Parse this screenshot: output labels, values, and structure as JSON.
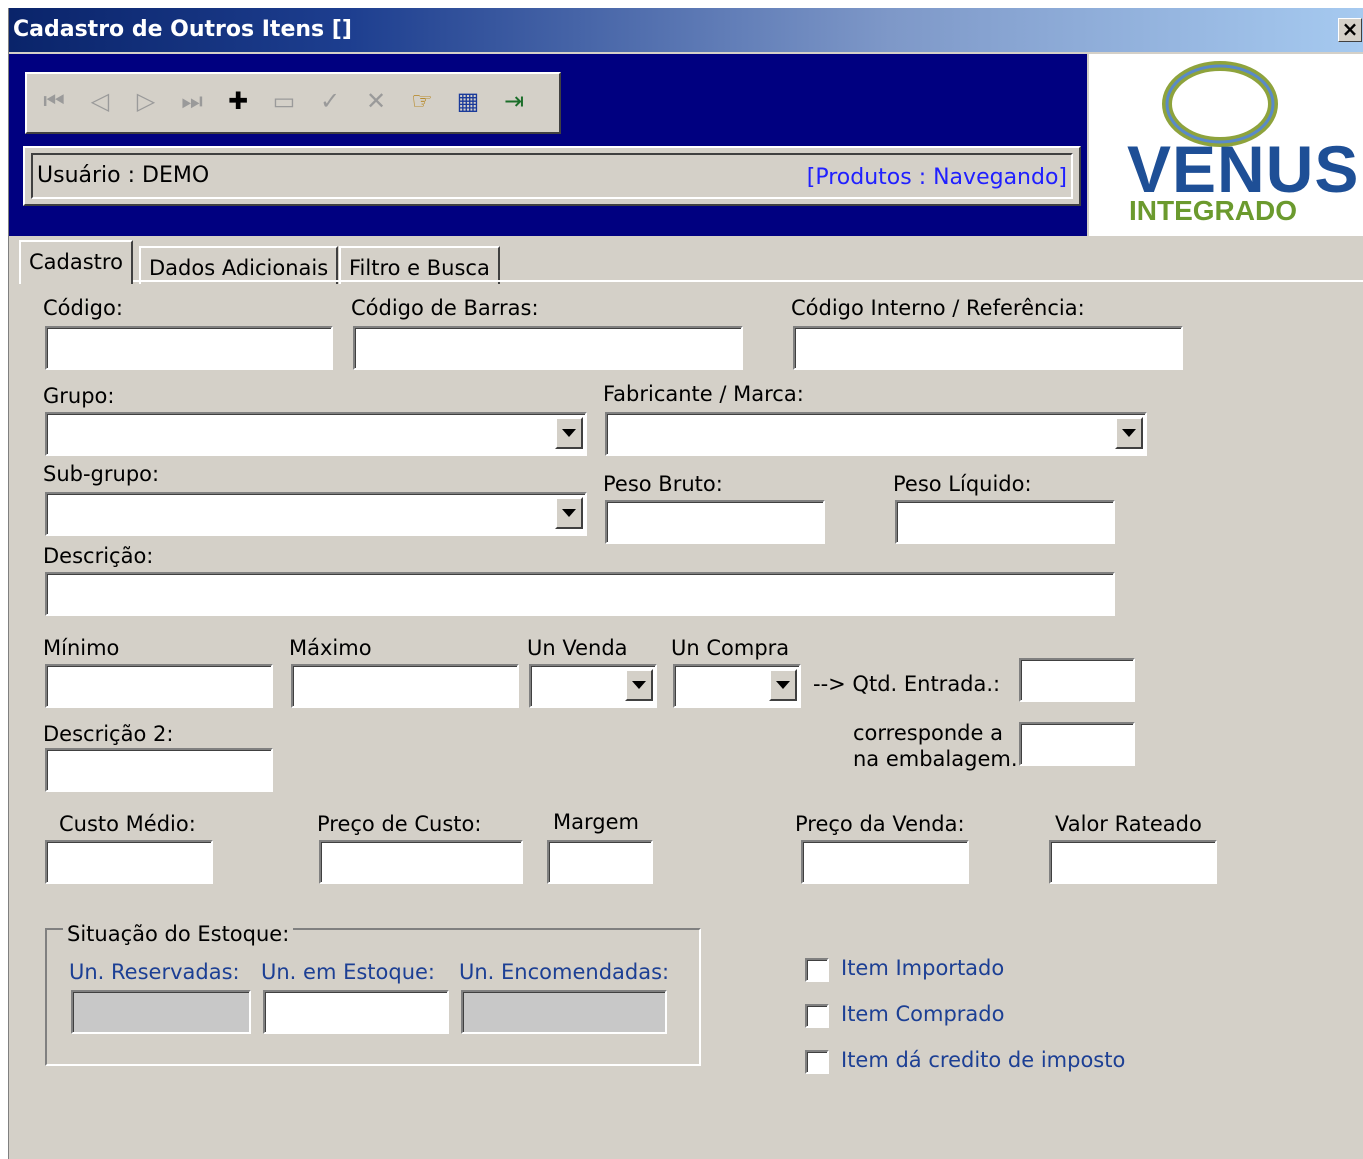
{
  "window": {
    "title": "Cadastro de Outros Itens []",
    "close_label": "×"
  },
  "toolbar": {
    "buttons": [
      {
        "name": "first-record-icon",
        "glyph": "⏮"
      },
      {
        "name": "previous-record-icon",
        "glyph": "◁"
      },
      {
        "name": "next-record-icon",
        "glyph": "▷"
      },
      {
        "name": "last-record-icon",
        "glyph": "⏭"
      },
      {
        "name": "add-record-icon",
        "glyph": "✚"
      },
      {
        "name": "delete-record-icon",
        "glyph": "▭"
      },
      {
        "name": "confirm-icon",
        "glyph": "✓"
      },
      {
        "name": "cancel-icon",
        "glyph": "✕"
      },
      {
        "name": "pointing-hand-icon",
        "glyph": "☞"
      },
      {
        "name": "calendar-icon",
        "glyph": "▦"
      },
      {
        "name": "exit-door-icon",
        "glyph": "🚪"
      }
    ]
  },
  "status": {
    "user": "Usuário : DEMO",
    "mode": "[Produtos : Navegando]"
  },
  "logo": {
    "line1": "VENUS",
    "line2": "INTEGRADO",
    "ring_color": "#8ea33c",
    "brand_blue": "#1e4f96",
    "brand_green": "#6b9a2e"
  },
  "tabs": [
    "Cadastro",
    "Dados Adicionais",
    "Filtro e Busca"
  ],
  "labels": {
    "codigo": "Código:",
    "codigo_barras": "Código de Barras:",
    "codigo_interno": "Código Interno / Referência:",
    "grupo": "Grupo:",
    "fabricante": "Fabricante / Marca:",
    "subgrupo": "Sub-grupo:",
    "peso_bruto": "Peso Bruto:",
    "peso_liquido": "Peso Líquido:",
    "descricao": "Descrição:",
    "minimo": "Mínimo",
    "maximo": "Máximo",
    "un_venda": "Un Venda",
    "un_compra": "Un Compra",
    "qtd_entrada": "--> Qtd. Entrada.:",
    "descricao2": "Descrição 2:",
    "corresponde1": "corresponde a",
    "corresponde2": "na embalagem.",
    "custo_medio": "Custo Médio:",
    "preco_custo": "Preço de Custo:",
    "margem": "Margem",
    "preco_venda": "Preço da Venda:",
    "valor_rateado": "Valor Rateado"
  },
  "estoque": {
    "title": "Situação do Estoque:",
    "reservadas": "Un. Reservadas:",
    "em_estoque": "Un. em Estoque:",
    "encomendadas": "Un. Encomendadas:"
  },
  "checkboxes": [
    {
      "label": "Item Importado",
      "checked": false
    },
    {
      "label": "Item Comprado",
      "checked": false
    },
    {
      "label": "Item dá credito de imposto",
      "checked": false
    }
  ]
}
